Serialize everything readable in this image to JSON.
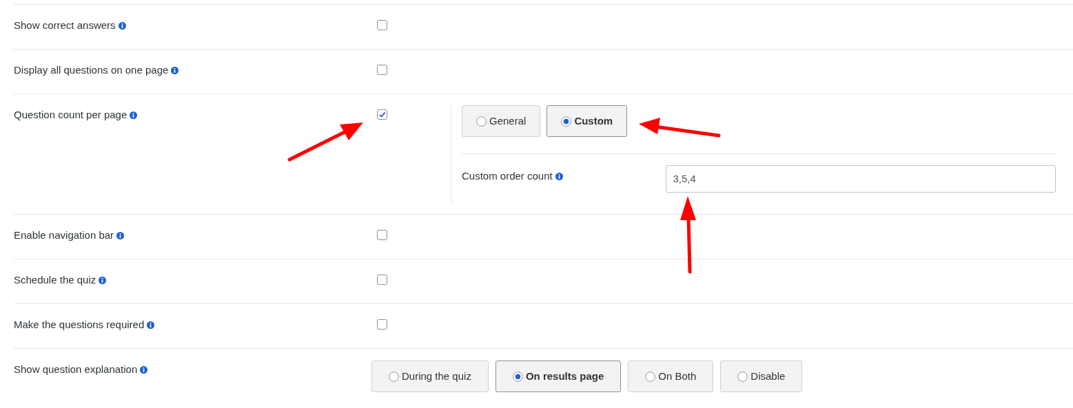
{
  "settings": [
    {
      "kind": "checkbox",
      "label": "Show correct answers",
      "checked": false
    },
    {
      "kind": "checkbox",
      "label": "Display all questions on one page",
      "checked": false
    },
    {
      "kind": "checkbox",
      "label": "Question count per page",
      "checked": true,
      "options": [
        {
          "label": "General",
          "selected": false
        },
        {
          "label": "Custom",
          "selected": true
        }
      ],
      "sub_field": {
        "label": "Custom order count",
        "value": "3,5,4"
      }
    },
    {
      "kind": "checkbox",
      "label": "Enable navigation bar",
      "checked": false
    },
    {
      "kind": "checkbox",
      "label": "Schedule the quiz",
      "checked": false
    },
    {
      "kind": "checkbox",
      "label": "Make the questions required",
      "checked": false
    },
    {
      "kind": "radio",
      "label": "Show question explanation",
      "options": [
        {
          "label": "During the quiz",
          "selected": false
        },
        {
          "label": "On results page",
          "selected": true
        },
        {
          "label": "On Both",
          "selected": false
        },
        {
          "label": "Disable",
          "selected": false
        }
      ]
    }
  ]
}
